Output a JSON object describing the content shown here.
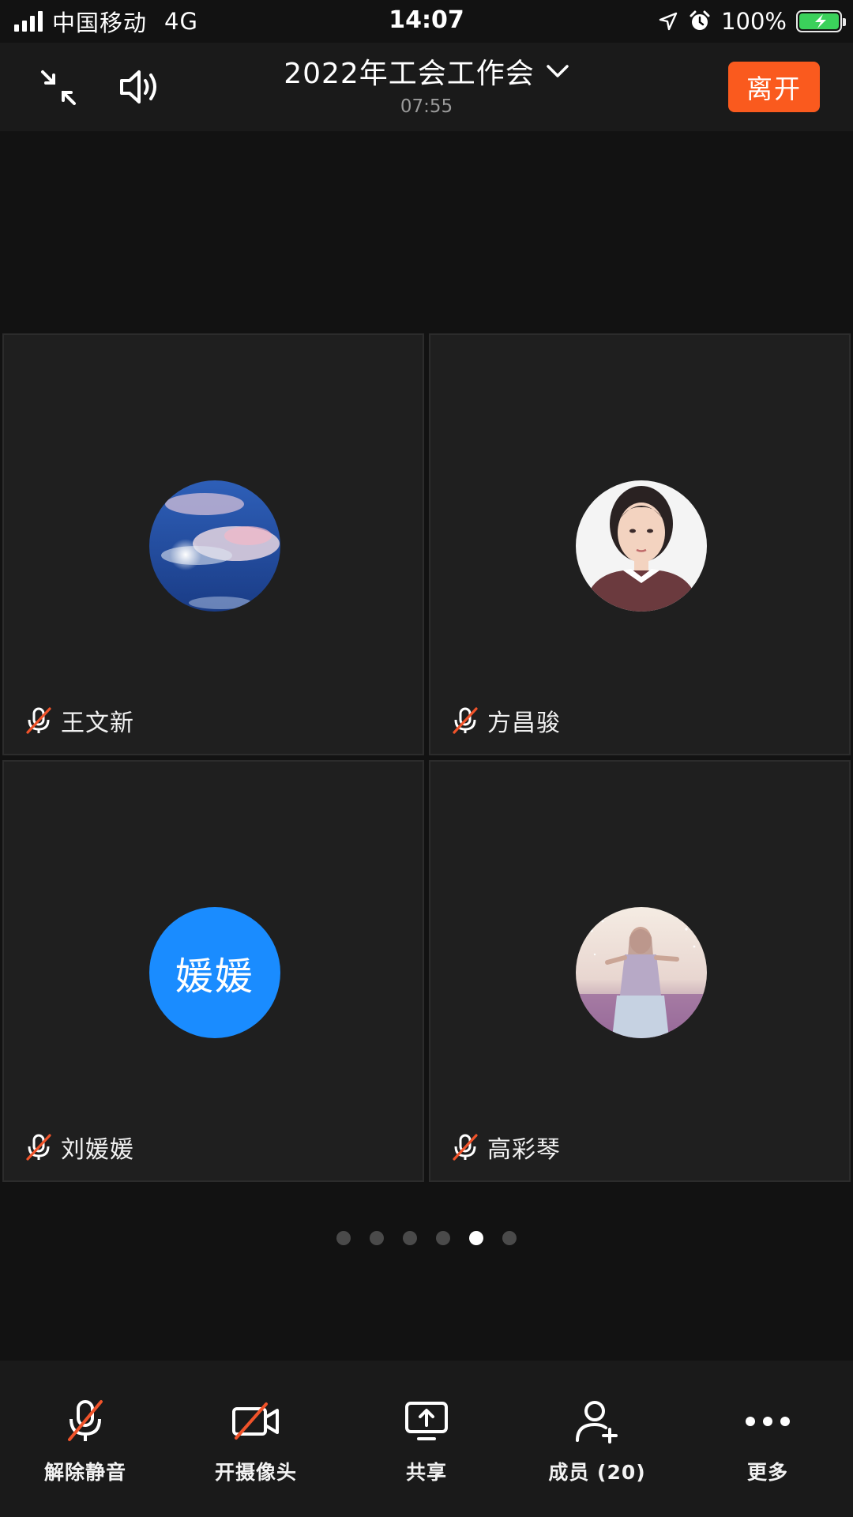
{
  "status_bar": {
    "carrier": "中国移动",
    "network": "4G",
    "time": "14:07",
    "battery_percent": "100%",
    "icons": [
      "signal-icon",
      "location-arrow-icon",
      "alarm-icon",
      "battery-charging-icon"
    ]
  },
  "header": {
    "title": "2022年工会工作会",
    "timer": "07:55",
    "leave_label": "离开",
    "icons": [
      "exit-fullscreen-icon",
      "speaker-icon",
      "chevron-down-icon"
    ]
  },
  "participants": [
    {
      "name": "王文新",
      "avatar": "sky-photo",
      "muted": true
    },
    {
      "name": "方昌骏",
      "avatar": "portrait-photo",
      "muted": true
    },
    {
      "name": "刘媛媛",
      "avatar_text": "媛媛",
      "avatar": "text",
      "muted": true
    },
    {
      "name": "高彩琴",
      "avatar": "field-photo",
      "muted": true
    }
  ],
  "pagination": {
    "total": 6,
    "active_index": 4
  },
  "toolbar": {
    "items": [
      {
        "label": "解除静音",
        "icon": "mic-muted-icon"
      },
      {
        "label": "开摄像头",
        "icon": "camera-off-icon"
      },
      {
        "label": "共享",
        "icon": "screen-share-icon"
      },
      {
        "label": "成员 (20)",
        "icon": "add-member-icon"
      },
      {
        "label": "更多",
        "icon": "more-icon"
      }
    ]
  },
  "colors": {
    "accent_leave": "#fa5a1e",
    "mute_slash": "#f0532a",
    "avatar_blue": "#1a8cff",
    "background": "#121212",
    "tile": "#1f1f1f"
  }
}
